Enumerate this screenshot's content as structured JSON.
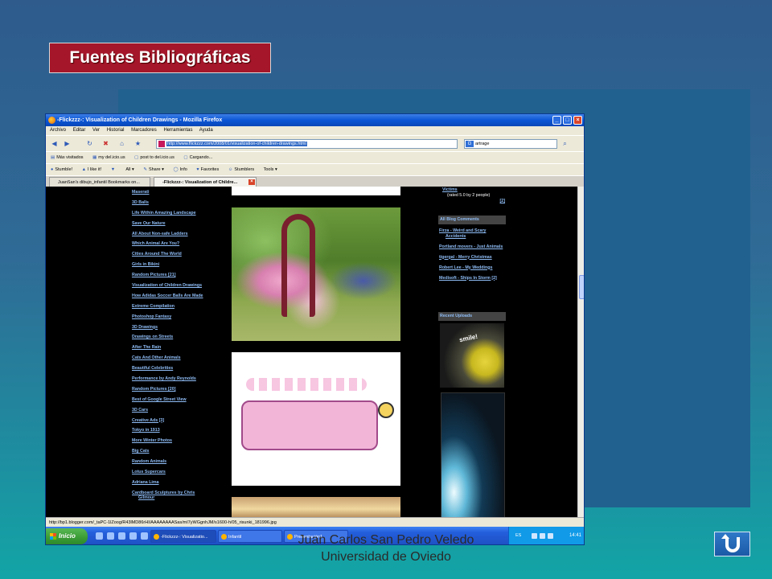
{
  "slide": {
    "title": "Fuentes Bibliográficas",
    "footer_line1": "Juan Carlos San Pedro Veledo",
    "footer_line2": "Universidad de Oviedo"
  },
  "browser": {
    "window_title": "-Flickzzz-: Visualization of Children Drawings - Mozilla Firefox",
    "menu": [
      "Archivo",
      "Editar",
      "Ver",
      "Historial",
      "Marcadores",
      "Herramientas",
      "Ayuda"
    ],
    "url": "http://www.flickzzz.com/2008/01/visualization-of-children-drawings.html",
    "search_value": "artrage",
    "bookmarks": [
      "Más visitados",
      "my del.icio.us",
      "post to del.icio.us",
      "Cargando..."
    ],
    "stumble": [
      "Stumble!",
      "I like it!",
      "All",
      "Share",
      "Info",
      "Favorites",
      "Stumblers",
      "Tools"
    ],
    "tabs": [
      {
        "label": "JuanSan's dibujo_infantil Bookmarks on..."
      },
      {
        "label": "-Flickzzz-: Visualization of Childre..."
      }
    ],
    "status": "http://bp1.blogger.com/_taPC-1lZoog/R43lMD86rHI/AAAAAAAASas/mI7yWGgnhJM/s1600-h/05_risunki_181996.jpg"
  },
  "page": {
    "links": [
      "Maserati",
      "3D Balls",
      "Life Within Amazing Landscape",
      "Save Our Nature",
      "All About Non-safe Ladders",
      "Which Animal Are You?",
      "Cities Around The World",
      "Girls in Bikini",
      "Random Pictures [21]",
      "Visualization of Children Drawings",
      "How Adidas Soccer Balls Are Made",
      "Extreme Compilation",
      "Photoshop Fantasy",
      "3D Drawings",
      "Drawings on Streets",
      "After The Rain",
      "Cats And Other Animals",
      "Beautiful Celebrities",
      "Performance by Andy Reynolds",
      "Random Pictures [20]",
      "Best of Google Street View",
      "3D Cars",
      "Creative Ads [3]",
      "Tokyo in 1913",
      "More Winter Photos",
      "Big Cats",
      "Random Animals",
      "Lotus Supercars",
      "Adriana Lima",
      "Cardboard Sculptures by Chris Gilmour"
    ],
    "victims": "Victims",
    "rating": "(rated 5.0 by 2 people)",
    "rating_link": "[2]",
    "comments_header": "All Blog Comments",
    "comments": [
      "Firza - Weird and Scary Accidents",
      "Portland movers - Just Animals",
      "tigergal - Merry Christmas",
      "Robert Lee - My Weddings",
      "Medisoft - Ships In Storm [2]"
    ],
    "uploads_header": "Recent Uploads",
    "upload_text": "smile!"
  },
  "taskbar": {
    "start": "Inicio",
    "buttons": [
      "-Flickzzz-: Visualizatio...",
      "Infantil",
      "Presentación1"
    ],
    "lang": "ES",
    "time": "14:41"
  }
}
